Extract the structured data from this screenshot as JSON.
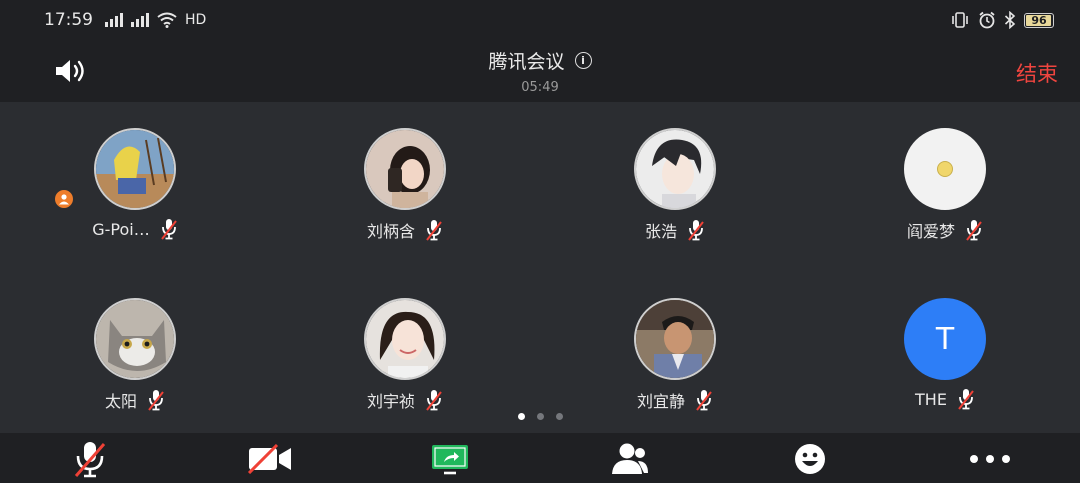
{
  "status_bar": {
    "time": "17:59",
    "network": "HD",
    "battery": "96"
  },
  "header": {
    "title": "腾讯会议",
    "timer": "05:49",
    "end_label": "结束"
  },
  "participants": [
    {
      "name": "G-Poi…",
      "avatar": "photo",
      "host": true,
      "muted": true
    },
    {
      "name": "刘柄含",
      "avatar": "photo",
      "host": false,
      "muted": true
    },
    {
      "name": "张浩",
      "avatar": "photo",
      "host": false,
      "muted": true
    },
    {
      "name": "阎爱梦",
      "avatar": "photo",
      "host": false,
      "muted": true
    },
    {
      "name": "太阳",
      "avatar": "photo",
      "host": false,
      "muted": true
    },
    {
      "name": "刘宇祯",
      "avatar": "photo",
      "host": false,
      "muted": true
    },
    {
      "name": "刘宜静",
      "avatar": "photo",
      "host": false,
      "muted": true
    },
    {
      "name": "THE",
      "avatar": "letter",
      "avatar_letter": "T",
      "host": false,
      "muted": true
    }
  ],
  "pager": {
    "pages": 3,
    "current": 1
  },
  "toolbar": [
    "mic-muted-icon",
    "camera-off-icon",
    "share-screen-icon",
    "participants-icon",
    "emoji-icon",
    "more-icon"
  ],
  "colors": {
    "accent": "#2d7ef7",
    "danger": "#f0453f",
    "share": "#20b85c",
    "host_badge": "#ee7d2b"
  }
}
